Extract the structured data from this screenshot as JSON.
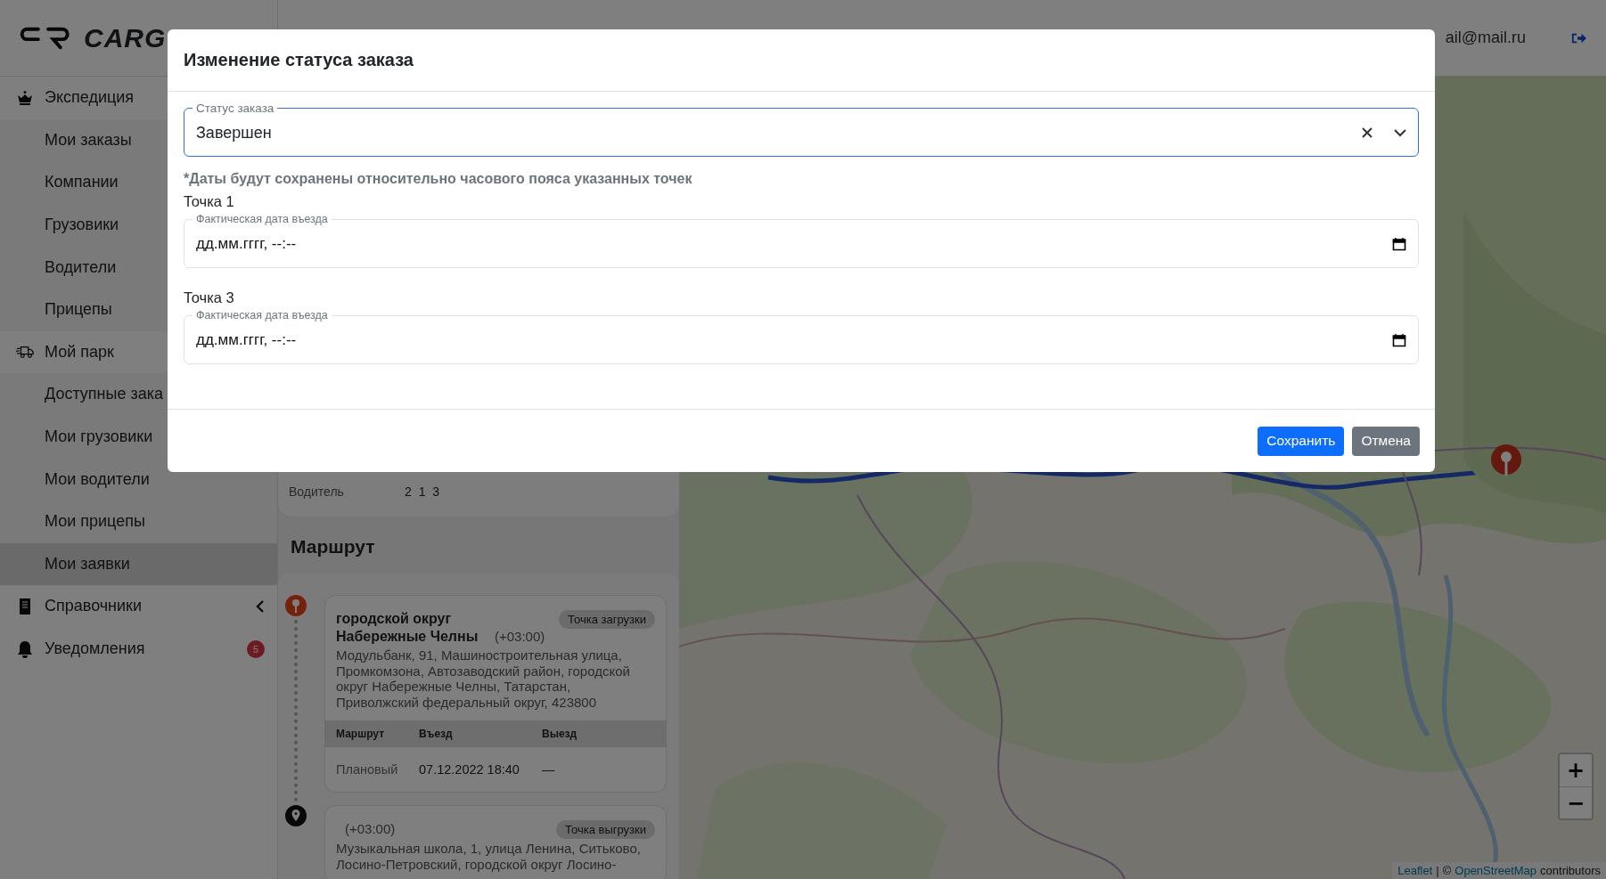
{
  "header": {
    "logo": "CARG",
    "user_email": "ail@mail.ru"
  },
  "sidebar": {
    "items": [
      {
        "label": "Экспедиция",
        "children": [
          {
            "label": "Мои заказы",
            "selected": false
          },
          {
            "label": "Компании",
            "selected": false
          },
          {
            "label": "Грузовики",
            "selected": false
          },
          {
            "label": "Водители",
            "selected": false
          },
          {
            "label": "Прицепы",
            "selected": false
          }
        ]
      },
      {
        "label": "Мой парк",
        "children": [
          {
            "label": "Доступные зака",
            "selected": false
          },
          {
            "label": "Мои грузовики",
            "selected": false
          },
          {
            "label": "Мои водители",
            "selected": false
          },
          {
            "label": "Мои прицепы",
            "selected": false
          },
          {
            "label": "Мои заявки",
            "selected": true
          }
        ]
      },
      {
        "label": "Справочники",
        "expanded": false
      },
      {
        "label": "Уведомления",
        "badge": "5"
      }
    ]
  },
  "order_details": {
    "driver_label": "Водитель",
    "driver_value": "2 1 3"
  },
  "route": {
    "title": "Маршрут",
    "points": [
      {
        "kind": "loading",
        "title": "городской округ Набережные Челны",
        "timezone": "(+03:00)",
        "tag": "Точка загрузки",
        "address": "Модульбанк, 91, Машиностроительная улица, Промкомзона, Автозаводский район, городской округ Набережные Челны, Татарстан, Приволжский федеральный округ, 423800",
        "table": {
          "columns": [
            "Маршрут",
            "Въезд",
            "Выезд"
          ],
          "rows": [
            [
              "Плановый",
              "07.12.2022 18:40",
              "—"
            ]
          ]
        }
      },
      {
        "kind": "unloading",
        "timezone": "(+03:00)",
        "tag": "Точка выгрузки",
        "address": "Музыкальная школа, 1, улица Ленина, Ситьково, Лосино-Петровский, городской округ Лосино-"
      }
    ]
  },
  "map": {
    "zoom_in": "+",
    "zoom_out": "−",
    "attribution": {
      "link1": "Leaflet",
      "separator": "|",
      "copyright": "©",
      "link2": "OpenStreetMap",
      "suffix": "contributors"
    }
  },
  "modal": {
    "title": "Изменение статуса заказа",
    "status_field": {
      "label": "Статус заказа",
      "value": "Завершен",
      "focused": true
    },
    "note": "*Даты будут сохранены относительно часового пояса указанных точек",
    "points": [
      {
        "title": "Точка 1",
        "field_label": "Фактическая дата въезда",
        "placeholder": "дд.мм.гггг, --:--"
      },
      {
        "title": "Точка 3",
        "field_label": "Фактическая дата въезда",
        "placeholder": "дд.мм.гггг, --:--"
      }
    ],
    "buttons": [
      {
        "label": "Сохранить",
        "kind": "primary"
      },
      {
        "label": "Отмена",
        "kind": "secondary"
      }
    ]
  }
}
